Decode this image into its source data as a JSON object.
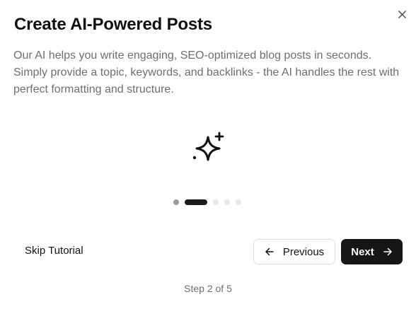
{
  "dialog": {
    "title": "Create AI-Powered Posts",
    "description": "Our AI helps you write engaging, SEO-optimized blog posts in seconds. Simply provide a topic, keywords, and backlinks - the AI handles the rest with perfect formatting and structure.",
    "hero_icon": "sparkles-icon",
    "close_icon": "close-icon"
  },
  "progress": {
    "total_steps": 5,
    "current_step": 2
  },
  "actions": {
    "skip_label": "Skip Tutorial",
    "previous_label": "Previous",
    "next_label": "Next"
  },
  "footer": {
    "step_text": "Step 2 of 5"
  }
}
